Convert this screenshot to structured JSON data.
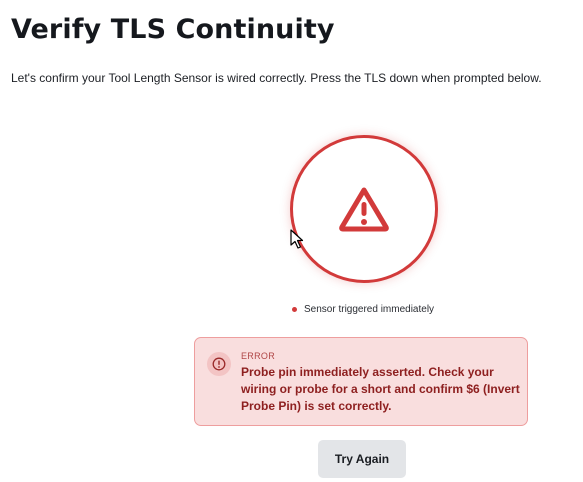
{
  "page": {
    "title": "Verify TLS Continuity",
    "subtitle": "Let's confirm your Tool Length Sensor is wired correctly. Press the TLS down when prompted below."
  },
  "status": {
    "icon": "warning-triangle-icon",
    "text": "Sensor triggered immediately",
    "color": "#d23a3a"
  },
  "error": {
    "icon": "alert-circle-icon",
    "label": "ERROR",
    "message": "Probe pin immediately asserted. Check your wiring or probe for a short and confirm $6 (Invert Probe Pin) is set correctly.",
    "background": "#f9dede",
    "border": "#ee9e9e",
    "text_color": "#8e2020"
  },
  "actions": {
    "try_again_label": "Try Again"
  }
}
